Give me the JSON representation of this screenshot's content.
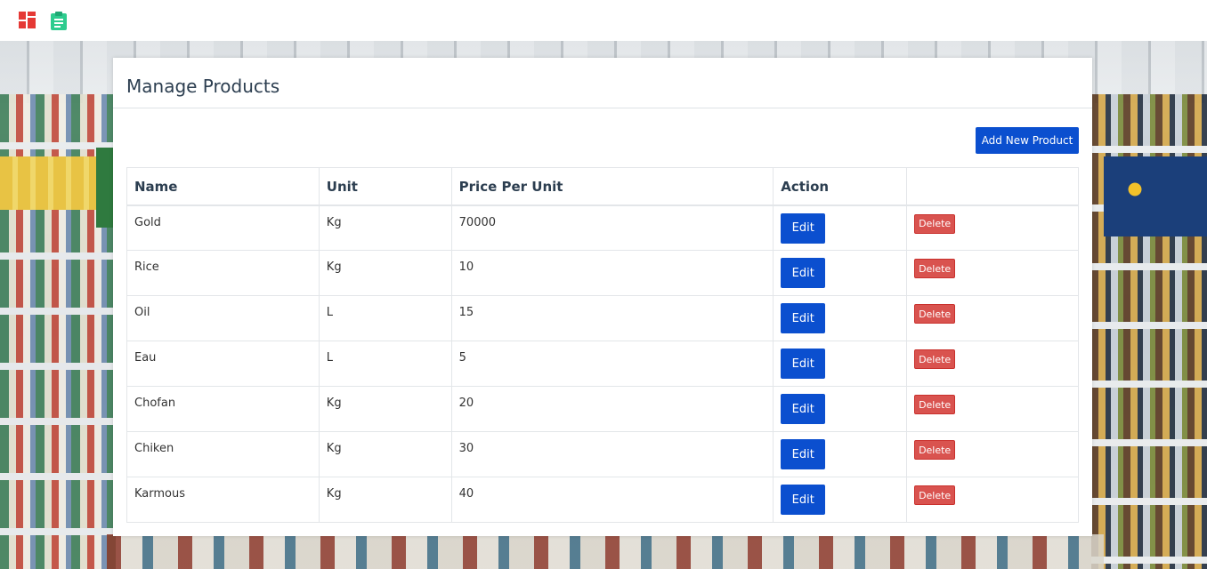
{
  "topbar": {
    "icons": [
      "dashboard-icon",
      "clipboard-icon"
    ],
    "dashboard_color": "#e53935",
    "clipboard_color": "#2ecc8f"
  },
  "page": {
    "title": "Manage Products",
    "add_button_label": "Add New Product"
  },
  "table": {
    "headers": [
      "Name",
      "Unit",
      "Price Per Unit",
      "Action",
      ""
    ],
    "rows": [
      {
        "name": "Gold",
        "unit": "Kg",
        "price": "70000",
        "edit": "Edit",
        "delete": "Delete"
      },
      {
        "name": "Rice",
        "unit": "Kg",
        "price": "10",
        "edit": "Edit",
        "delete": "Delete"
      },
      {
        "name": "Oil",
        "unit": "L",
        "price": "15",
        "edit": "Edit",
        "delete": "Delete"
      },
      {
        "name": "Eau",
        "unit": "L",
        "price": "5",
        "edit": "Edit",
        "delete": "Delete"
      },
      {
        "name": "Chofan",
        "unit": "Kg",
        "price": "20",
        "edit": "Edit",
        "delete": "Delete"
      },
      {
        "name": "Chiken",
        "unit": "Kg",
        "price": "30",
        "edit": "Edit",
        "delete": "Delete"
      },
      {
        "name": "Karmous",
        "unit": "Kg",
        "price": "40",
        "edit": "Edit",
        "delete": "Delete"
      }
    ]
  },
  "colors": {
    "primary": "#0b4fcf",
    "danger": "#d9534f"
  }
}
